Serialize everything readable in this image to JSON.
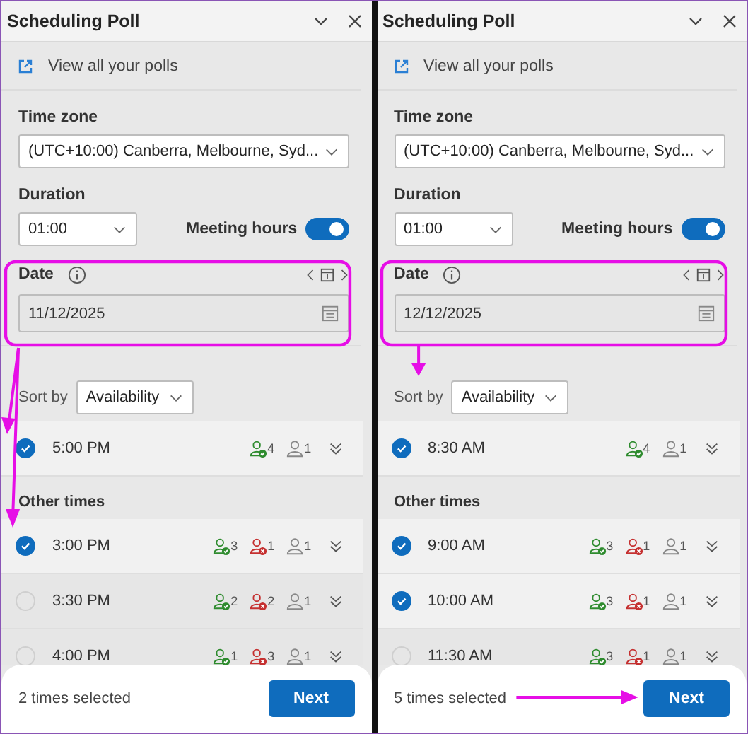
{
  "panels": [
    {
      "title": "Scheduling Poll",
      "link": "View all your polls",
      "time_zone": {
        "label": "Time zone",
        "value": "(UTC+10:00) Canberra, Melbourne, Syd..."
      },
      "duration": {
        "label": "Duration",
        "value": "01:00"
      },
      "meeting_hours": {
        "label": "Meeting hours",
        "on": true
      },
      "date": {
        "label": "Date",
        "value": "11/12/2025"
      },
      "sort": {
        "label": "Sort by",
        "value": "Availability"
      },
      "top_rows": [
        {
          "time": "5:00 PM",
          "selected": true,
          "accepted": "4",
          "declined": null,
          "unknown": "1"
        }
      ],
      "other_label": "Other times",
      "other_rows": [
        {
          "time": "3:00 PM",
          "selected": true,
          "accepted": "3",
          "declined": "1",
          "unknown": "1"
        },
        {
          "time": "3:30 PM",
          "selected": false,
          "accepted": "2",
          "declined": "2",
          "unknown": "1"
        },
        {
          "time": "4:00 PM",
          "selected": false,
          "accepted": "1",
          "declined": "3",
          "unknown": "1"
        }
      ],
      "footer": {
        "count": "2 times selected",
        "button": "Next"
      },
      "annotations": [
        {
          "kind": "date-frame"
        },
        {
          "kind": "arrow-top-row"
        },
        {
          "kind": "arrow-other-row"
        }
      ]
    },
    {
      "title": "Scheduling Poll",
      "link": "View all your polls",
      "time_zone": {
        "label": "Time zone",
        "value": "(UTC+10:00) Canberra, Melbourne, Syd..."
      },
      "duration": {
        "label": "Duration",
        "value": "01:00"
      },
      "meeting_hours": {
        "label": "Meeting hours",
        "on": true
      },
      "date": {
        "label": "Date",
        "value": "12/12/2025"
      },
      "sort": {
        "label": "Sort by",
        "value": "Availability"
      },
      "top_rows": [
        {
          "time": "8:30 AM",
          "selected": true,
          "accepted": "4",
          "declined": null,
          "unknown": "1"
        }
      ],
      "other_label": "Other times",
      "other_rows": [
        {
          "time": "9:00 AM",
          "selected": true,
          "accepted": "3",
          "declined": "1",
          "unknown": "1"
        },
        {
          "time": "10:00 AM",
          "selected": true,
          "accepted": "3",
          "declined": "1",
          "unknown": "1"
        },
        {
          "time": "11:30 AM",
          "selected": false,
          "accepted": "3",
          "declined": "1",
          "unknown": "1"
        }
      ],
      "footer": {
        "count": "5 times selected",
        "button": "Next"
      },
      "annotations": [
        {
          "kind": "date-frame"
        },
        {
          "kind": "arrow-sort"
        },
        {
          "kind": "arrow-next"
        }
      ]
    }
  ]
}
